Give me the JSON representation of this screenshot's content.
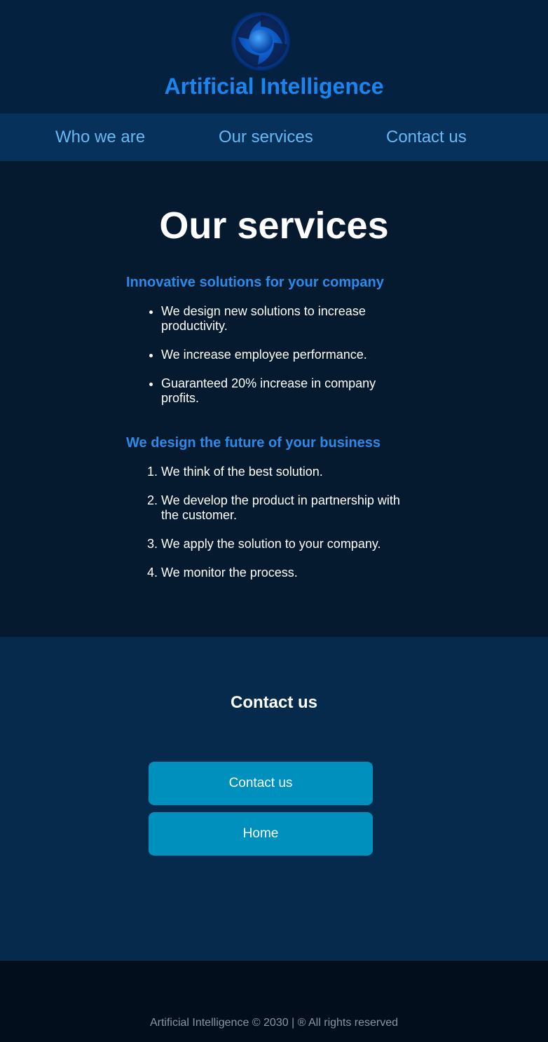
{
  "header": {
    "logo_icon": "swirl-orb-logo-icon",
    "title": "Artificial Intelligence"
  },
  "nav": {
    "items": [
      {
        "label": "Who we are"
      },
      {
        "label": "Our services"
      },
      {
        "label": "Contact us"
      }
    ]
  },
  "main": {
    "heading": "Our services",
    "section1": {
      "title": "Innovative solutions for your company",
      "items": [
        "We design new solutions to increase productivity.",
        "We increase employee performance.",
        "Guaranteed 20% increase in company profits."
      ]
    },
    "section2": {
      "title": "We design the future of your business",
      "items": [
        "We think of the best solution.",
        "We develop the product in partnership with the customer.",
        "We apply the solution to your company.",
        "We monitor the process."
      ]
    }
  },
  "contact": {
    "heading": "Contact us",
    "buttons": [
      {
        "label": "Contact us"
      },
      {
        "label": "Home"
      }
    ]
  },
  "footer": {
    "text": "Artificial Intelligence © 2030 | ® All rights reserved"
  },
  "colors": {
    "brand": "#1a85ef",
    "nav_link": "#68b8f4",
    "button": "#0090bd",
    "subheading": "#2d8ae8"
  }
}
